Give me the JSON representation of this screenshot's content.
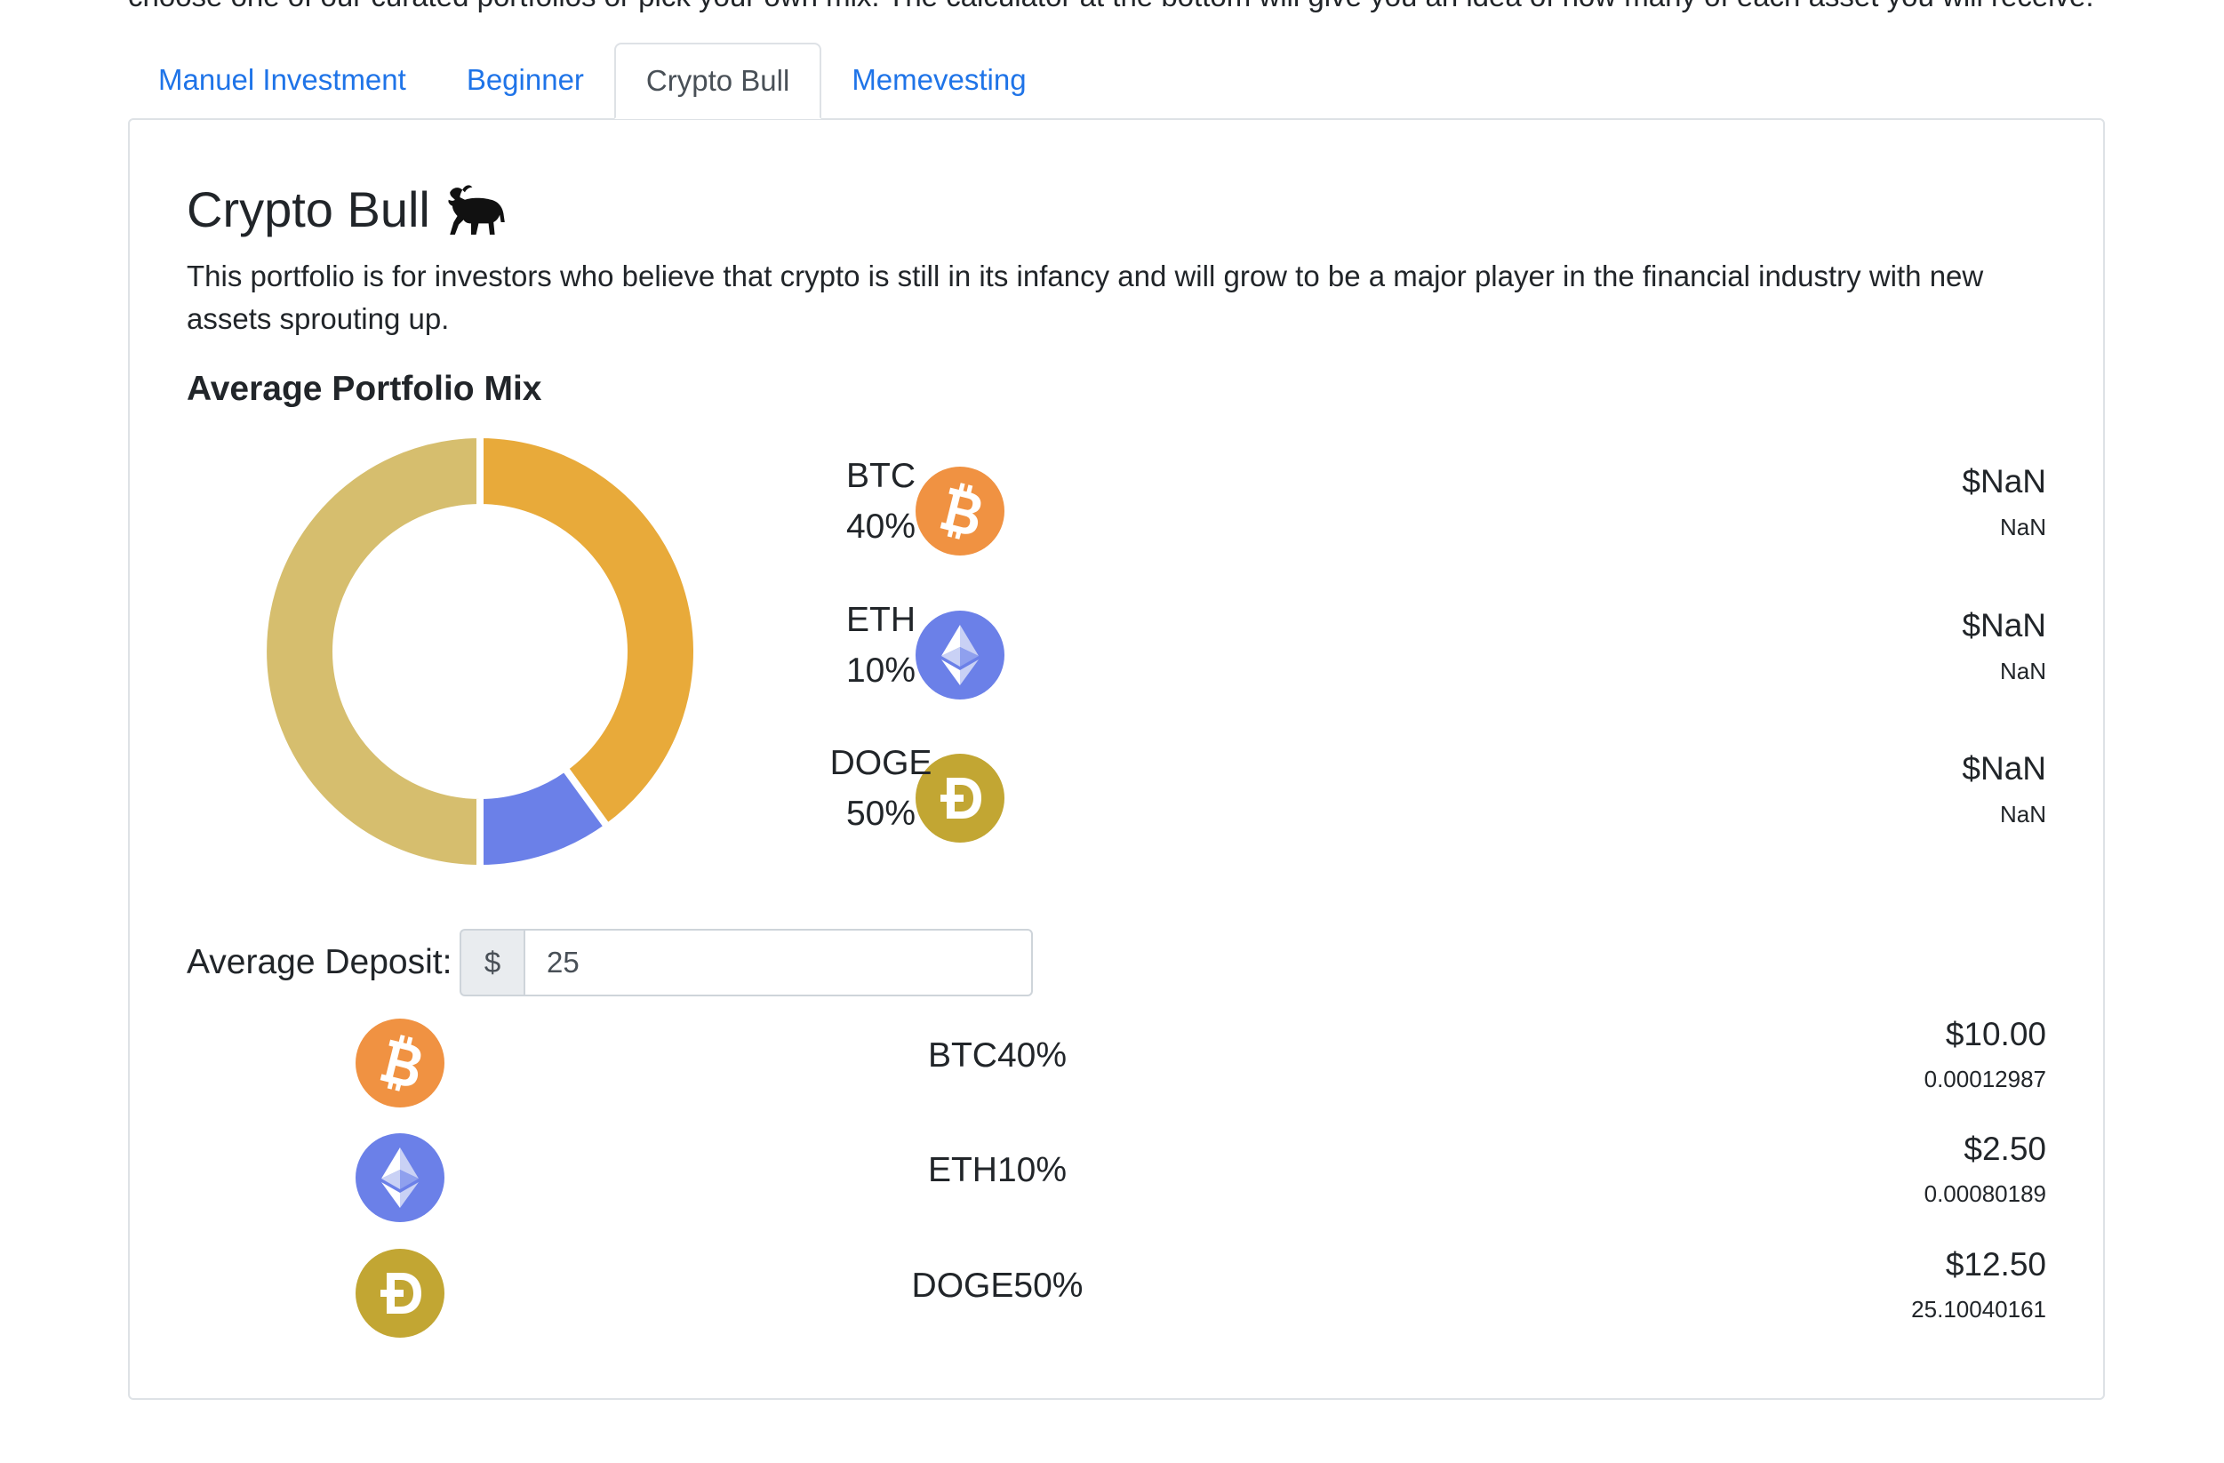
{
  "intro": "choose one of our curated portfolios or pick your own mix. The calculator at the bottom will give you an idea of how many of each asset you will receive.",
  "tabs": [
    "Manuel Investment",
    "Beginner",
    "Crypto Bull",
    "Memevesting"
  ],
  "active_tab": "Crypto Bull",
  "portfolio": {
    "title": "Crypto Bull",
    "title_icon": "bull-icon",
    "description": "This portfolio is for investors who believe that crypto is still in its infancy and will grow to be a major player in the financial industry with new assets sprouting up.",
    "mix_title": "Average Portfolio Mix",
    "assets": [
      {
        "symbol": "BTC",
        "percent": "40%",
        "usd": "$NaN",
        "amount": "NaN",
        "icon": "bitcoin-icon",
        "color": "#F09242"
      },
      {
        "symbol": "ETH",
        "percent": "10%",
        "usd": "$NaN",
        "amount": "NaN",
        "icon": "ethereum-icon",
        "color": "#6B80E8"
      },
      {
        "symbol": "DOGE",
        "percent": "50%",
        "usd": "$NaN",
        "amount": "NaN",
        "icon": "dogecoin-icon",
        "color": "#C2A633"
      }
    ]
  },
  "chart_data": {
    "type": "pie",
    "categories": [
      "BTC",
      "ETH",
      "DOGE"
    ],
    "values": [
      40,
      10,
      50
    ],
    "colors": [
      "#E8AA3A",
      "#6B80E8",
      "#D6BE6E"
    ]
  },
  "deposit": {
    "label": "Average Deposit:",
    "currency_symbol": "$",
    "value": "25"
  },
  "calculator": [
    {
      "label": "BTC40%",
      "usd": "$10.00",
      "amount": "0.00012987",
      "icon": "bitcoin-icon"
    },
    {
      "label": "ETH10%",
      "usd": "$2.50",
      "amount": "0.00080189",
      "icon": "ethereum-icon"
    },
    {
      "label": "DOGE50%",
      "usd": "$12.50",
      "amount": "25.10040161",
      "icon": "dogecoin-icon"
    }
  ]
}
